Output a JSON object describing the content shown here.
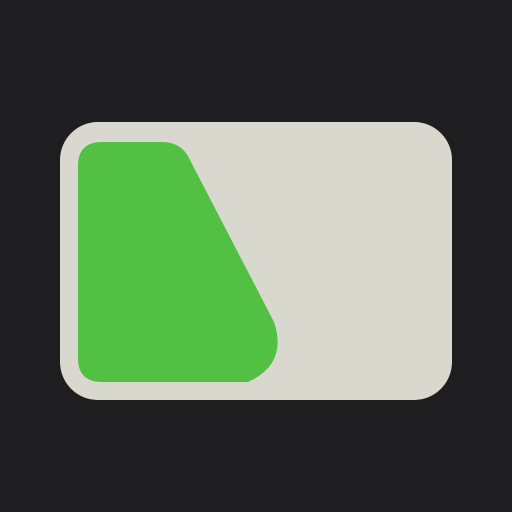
{
  "icon": {
    "name": "battery-level-icon",
    "level_percent": 40
  },
  "colors": {
    "background": "#1e1e20",
    "card": "#d9d8cf",
    "fill": "#52c043"
  }
}
